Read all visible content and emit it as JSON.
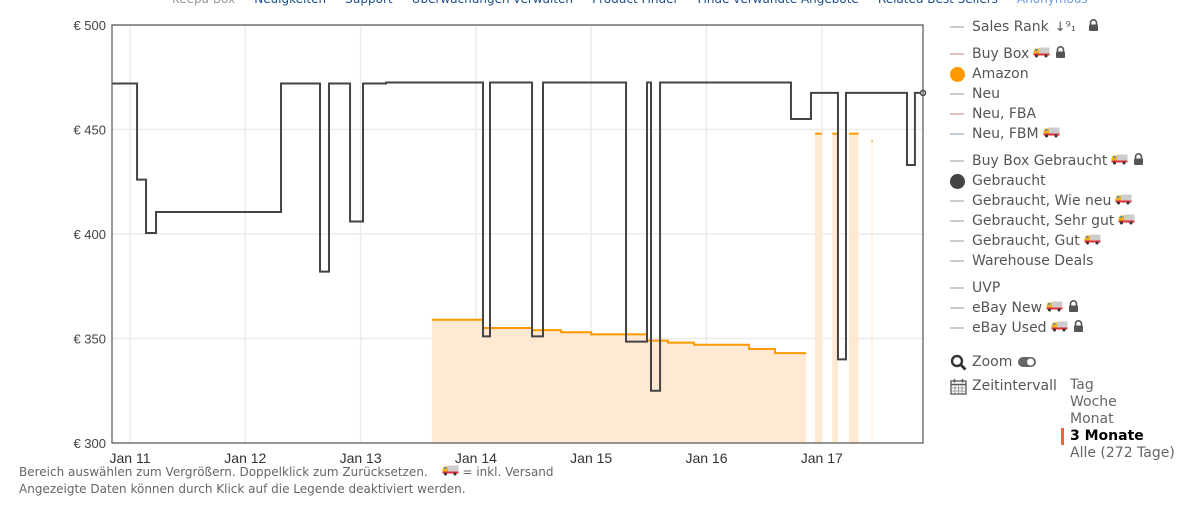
{
  "nav": {
    "items": [
      "Keepa Box",
      "Neuigkeiten",
      "Support",
      "Überwachungen verwalten",
      "Product Finder",
      "Finde verwandte Angebote",
      "Related Best Sellers",
      "Anonymous"
    ],
    "separator": "•"
  },
  "chart_data": {
    "type": "line",
    "xlabel": "",
    "ylabel": "",
    "currency_prefix": "€",
    "ylim": [
      300,
      500
    ],
    "yticks": [
      "€ 300",
      "€ 350",
      "€ 400",
      "€ 450",
      "€ 500"
    ],
    "ytick_values": [
      300,
      350,
      400,
      450,
      500
    ],
    "xrange": [
      "Jan 10 20:15",
      "Jan 17 21:04"
    ],
    "xticks": [
      "Jan 11",
      "Jan 12",
      "Jan 13",
      "Jan 14",
      "Jan 15",
      "Jan 16",
      "Jan 17"
    ],
    "grid": true,
    "legend_placement": "right",
    "series": [
      {
        "name": "Amazon",
        "color": "#ff9900",
        "fill": "#ffe9d3",
        "style": "step-area",
        "segments": [
          {
            "points": [
              [
                "Jan 13 14:51",
                359
              ],
              [
                "Jan 14 01:29",
                355
              ],
              [
                "Jan 14 11:41",
                354
              ],
              [
                "Jan 14 17:42",
                353
              ],
              [
                "Jan 15 00:00",
                352
              ],
              [
                "Jan 15 11:37",
                349
              ],
              [
                "Jan 15 15:59",
                348
              ],
              [
                "Jan 15 21:25",
                347
              ],
              [
                "Jan 16 08:51",
                345
              ],
              [
                "Jan 16 14:15",
                343
              ]
            ],
            "end": "Jan 16 20:43"
          },
          {
            "points": [
              [
                "Jan 16 22:35",
                448
              ]
            ],
            "end": "Jan 17 00:00"
          },
          {
            "points": [
              [
                "Jan 17 02:11",
                448
              ]
            ],
            "end": "Jan 17 03:22"
          },
          {
            "points": [
              [
                "Jan 17 05:40",
                448
              ]
            ],
            "end": "Jan 17 07:40"
          },
          {
            "points": [
              [
                "Jan 17 10:20",
                444.5
              ]
            ],
            "end": "Jan 17 10:35"
          }
        ]
      },
      {
        "name": "Gebraucht",
        "color": "#444444",
        "style": "step",
        "points": [
          [
            "Jan 10 20:15",
            472
          ],
          [
            "Jan 11 01:28",
            426
          ],
          [
            "Jan 11 03:20",
            400.5
          ],
          [
            "Jan 11 05:25",
            410.5
          ],
          [
            "Jan 12 07:26",
            472
          ],
          [
            "Jan 12 15:33",
            382
          ],
          [
            "Jan 12 17:25",
            472
          ],
          [
            "Jan 12 21:48",
            406
          ],
          [
            "Jan 13 00:30",
            472
          ],
          [
            "Jan 13 05:17",
            472.5
          ],
          [
            "Jan 14 01:29",
            351
          ],
          [
            "Jan 14 02:56",
            472.5
          ],
          [
            "Jan 14 11:41",
            351
          ],
          [
            "Jan 14 13:58",
            472.5
          ],
          [
            "Jan 15 07:15",
            348.5
          ],
          [
            "Jan 15 11:37",
            472.5
          ],
          [
            "Jan 15 12:27",
            325
          ],
          [
            "Jan 15 14:20",
            472.5
          ],
          [
            "Jan 16 17:35",
            455
          ],
          [
            "Jan 16 21:45",
            467.5
          ],
          [
            "Jan 17 03:22",
            340
          ],
          [
            "Jan 17 05:02",
            467.5
          ],
          [
            "Jan 17 17:44",
            433
          ],
          [
            "Jan 17 19:23",
            467.5
          ]
        ],
        "end": "Jan 17 21:04"
      }
    ]
  },
  "legend": {
    "items": [
      {
        "label": "Sales Rank",
        "swatch": "line",
        "color": "#cccccc",
        "sort_icon": "↓⁹₁",
        "lock": true
      },
      {
        "label": "Buy Box",
        "swatch": "line",
        "color": "#e0c0c0",
        "truck": true,
        "lock": true,
        "gap": true
      },
      {
        "label": "Amazon",
        "swatch": "dot",
        "color": "#ff9900"
      },
      {
        "label": "Neu",
        "swatch": "line",
        "color": "#cccccc"
      },
      {
        "label": "Neu, FBA",
        "swatch": "line",
        "color": "#e0c0c0"
      },
      {
        "label": "Neu, FBM",
        "swatch": "line",
        "color": "#c0ccd8",
        "truck": true
      },
      {
        "label": "Buy Box Gebraucht",
        "swatch": "line",
        "color": "#cccccc",
        "truck": true,
        "lock": true,
        "gap": true
      },
      {
        "label": "Gebraucht",
        "swatch": "dot",
        "color": "#444444"
      },
      {
        "label": "Gebraucht, Wie neu",
        "swatch": "line",
        "color": "#cccccc",
        "truck": true
      },
      {
        "label": "Gebraucht, Sehr gut",
        "swatch": "line",
        "color": "#cccccc",
        "truck": true
      },
      {
        "label": "Gebraucht, Gut",
        "swatch": "line",
        "color": "#cccccc",
        "truck": true
      },
      {
        "label": "Warehouse Deals",
        "swatch": "line",
        "color": "#cccccc"
      },
      {
        "label": "UVP",
        "swatch": "line",
        "color": "#cccccc",
        "gap": true
      },
      {
        "label": "eBay New",
        "swatch": "line",
        "color": "#cccccc",
        "truck": true,
        "lock": true
      },
      {
        "label": "eBay Used",
        "swatch": "line",
        "color": "#cccccc",
        "truck": true,
        "lock": true
      }
    ]
  },
  "tools": {
    "zoom_label": "Zoom",
    "zoom_enabled": true,
    "interval_label": "Zeitintervall",
    "ranges": [
      "Tag",
      "Woche",
      "Monat",
      "3 Monate",
      "Alle (272 Tage)"
    ],
    "selected_range": "3 Monate",
    "selected_color": "#f4623a"
  },
  "footer": {
    "line1": "Bereich auswählen zum Vergrößern. Doppelklick zum Zurücksetzen.",
    "truck_note": "= inkl. Versand",
    "line2": "Angezeigte Daten können durch Klick auf die Legende deaktiviert werden."
  }
}
